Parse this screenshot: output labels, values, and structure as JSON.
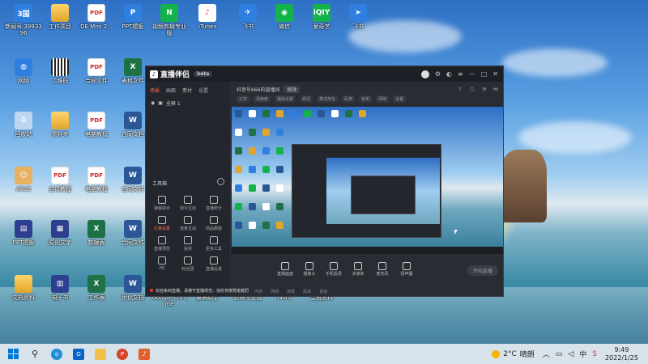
{
  "desktop": {
    "icons": [
      {
        "label": "新闻号\n3993396",
        "icon": "app-icon",
        "style": "g-blue",
        "glyph": "3国"
      },
      {
        "label": "工作项目",
        "icon": "folder-icon",
        "style": "g-folder",
        "glyph": ""
      },
      {
        "label": "DE Mini 2...",
        "icon": "pdf-icon",
        "style": "g-pdf",
        "glyph": "PDF"
      },
      {
        "label": "PPT模板",
        "icon": "ppt-icon",
        "style": "g-blue",
        "glyph": "P"
      },
      {
        "label": "视频剪辑专业版",
        "icon": "editor-icon",
        "style": "g-green",
        "glyph": "N"
      },
      {
        "label": "iTunes",
        "icon": "music-icon",
        "style": "g-music",
        "glyph": "♪"
      },
      {
        "label": "飞书",
        "icon": "feishu-icon",
        "style": "g-blue",
        "glyph": "✈"
      },
      {
        "label": "微信",
        "icon": "wechat-icon",
        "style": "g-green",
        "glyph": "◉"
      },
      {
        "label": "爱奇艺",
        "icon": "iqiyi-icon",
        "style": "g-green",
        "glyph": "iQIY"
      },
      {
        "label": "飞书",
        "icon": "feishu-icon",
        "style": "g-blue",
        "glyph": "➤"
      },
      {
        "label": "网络",
        "icon": "network-icon",
        "style": "g-blue",
        "glyph": "◍"
      },
      {
        "label": "二维码",
        "icon": "qrcode-icon",
        "style": "g-qr",
        "glyph": ""
      },
      {
        "label": "合同文件",
        "icon": "pdf-icon",
        "style": "g-pdf",
        "glyph": "PDF"
      },
      {
        "label": "表格文件",
        "icon": "excel-icon",
        "style": "g-excel",
        "glyph": "X"
      },
      {
        "label": "回收站",
        "icon": "recycle-bin-icon",
        "style": "g-recycle",
        "glyph": "♻"
      },
      {
        "label": "资料夹",
        "icon": "folder-icon",
        "style": "g-folder",
        "glyph": ""
      },
      {
        "label": "电脑教程",
        "icon": "pdf-icon",
        "style": "g-pdf",
        "glyph": "PDF"
      },
      {
        "label": "合同文档",
        "icon": "word-icon",
        "style": "g-word",
        "glyph": "W"
      },
      {
        "label": "ASUS",
        "icon": "user-icon",
        "style": "g-person",
        "glyph": "☺"
      },
      {
        "label": "会员教程",
        "icon": "pdf-icon",
        "style": "g-pdf",
        "glyph": "PDF"
      },
      {
        "label": "电脑教程",
        "icon": "pdf-icon",
        "style": "g-pdf",
        "glyph": "PDF"
      },
      {
        "label": "合同文件",
        "icon": "word-icon",
        "style": "g-word",
        "glyph": "W"
      },
      {
        "label": "PPT模板",
        "icon": "book-icon",
        "style": "g-book",
        "glyph": "▤"
      },
      {
        "label": "原创文字",
        "icon": "book-icon",
        "style": "g-book",
        "glyph": "▦"
      },
      {
        "label": "数据表",
        "icon": "excel-icon",
        "style": "g-excel",
        "glyph": "X"
      },
      {
        "label": "合同文件",
        "icon": "word-icon",
        "style": "g-word",
        "glyph": "W"
      },
      {
        "label": "文档资料",
        "icon": "folder-icon",
        "style": "g-folder",
        "glyph": ""
      },
      {
        "label": "电子书",
        "icon": "book-icon",
        "style": "g-book",
        "glyph": "▥"
      },
      {
        "label": "工作表",
        "icon": "excel-icon",
        "style": "g-excel",
        "glyph": "X"
      },
      {
        "label": "优化文档",
        "icon": "word-icon",
        "style": "g-word",
        "glyph": "W"
      },
      {
        "label": "Google Chrome",
        "icon": "chrome-icon",
        "style": "g-chrome",
        "glyph": ""
      },
      {
        "label": "录屏助手",
        "icon": "app-icon",
        "style": "g-blue",
        "glyph": "●"
      },
      {
        "label": "剪映专业版",
        "icon": "app-icon",
        "style": "g-green",
        "glyph": "✂"
      },
      {
        "label": "Word",
        "icon": "word-icon",
        "style": "g-word",
        "glyph": "W"
      },
      {
        "label": "会员资料",
        "icon": "folder-icon",
        "style": "g-folder",
        "glyph": ""
      }
    ]
  },
  "app": {
    "name": "直播伴侣",
    "version": "beta",
    "left_tabs": [
      "场景",
      "画面",
      "素材",
      "设置"
    ],
    "scene": "全屏 1",
    "tools_title": "工具箱",
    "tools": [
      {
        "label": "弹幕助手",
        "icon": "danmaku-icon",
        "hot": false
      },
      {
        "label": "观众互动",
        "icon": "audience-icon",
        "hot": false
      },
      {
        "label": "直播统计",
        "icon": "stats-icon",
        "hot": false
      },
      {
        "label": "礼物设置",
        "icon": "gift-icon",
        "hot": true
      },
      {
        "label": "连麦互动",
        "icon": "mic-link-icon",
        "hot": false
      },
      {
        "label": "商品橱窗",
        "icon": "shop-icon",
        "hot": false
      },
      {
        "label": "直播预告",
        "icon": "notice-icon",
        "hot": false
      },
      {
        "label": "投票",
        "icon": "vote-icon",
        "hot": false
      },
      {
        "label": "更多工具",
        "icon": "more-icon",
        "hot": false
      },
      {
        "label": "PK",
        "icon": "pk-icon",
        "hot": false
      },
      {
        "label": "粉丝团",
        "icon": "fans-icon",
        "hot": false
      },
      {
        "label": "直播设置",
        "icon": "settings-icon",
        "hot": false
      }
    ],
    "room_title": "抖音号666的直播间",
    "room_tag": "修改",
    "stats": [
      "分享",
      "清晰度",
      "播放设置",
      "高清",
      "推流地址",
      "码率",
      "帧率",
      "网络",
      "设置"
    ],
    "controls": [
      {
        "label": "直播画面",
        "icon": "screen-icon"
      },
      {
        "label": "摄像头",
        "icon": "camera-icon"
      },
      {
        "label": "手机投屏",
        "icon": "phone-cast-icon"
      },
      {
        "label": "多媒体",
        "icon": "media-icon"
      },
      {
        "label": "麦克风",
        "icon": "microphone-icon"
      },
      {
        "label": "扬声器",
        "icon": "speaker-icon"
      }
    ],
    "go_live": "开始直播",
    "main_status": [
      "CPU",
      "内存",
      "网络",
      "帧数",
      "码率",
      "丢帧"
    ],
    "notice": "欢迎来到直播，请遵守直播规范，违反将按规定处罚"
  },
  "taskbar": {
    "weather_temp": "2°C",
    "weather_text": "晴朗",
    "ime": "中",
    "time": "9:49",
    "date": "2022/1/25"
  }
}
